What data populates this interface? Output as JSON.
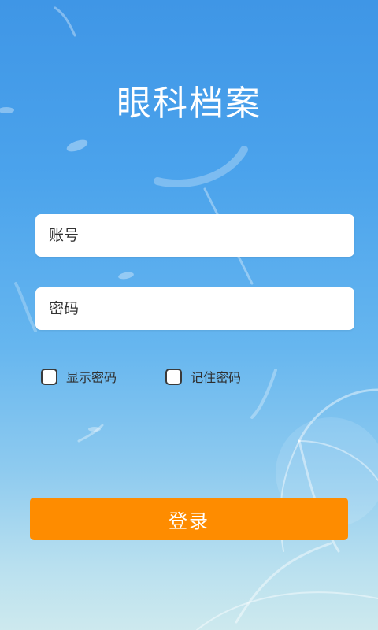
{
  "app": {
    "title": "眼科档案"
  },
  "form": {
    "account_placeholder": "账号",
    "password_placeholder": "密码"
  },
  "options": {
    "show_password_label": "显示密码",
    "show_password_checked": false,
    "remember_password_label": "记住密码",
    "remember_password_checked": false
  },
  "actions": {
    "login_label": "登录"
  },
  "colors": {
    "accent": "#fe8c00",
    "background_top": "#3f96e6",
    "background_bottom": "#cde9ee"
  }
}
